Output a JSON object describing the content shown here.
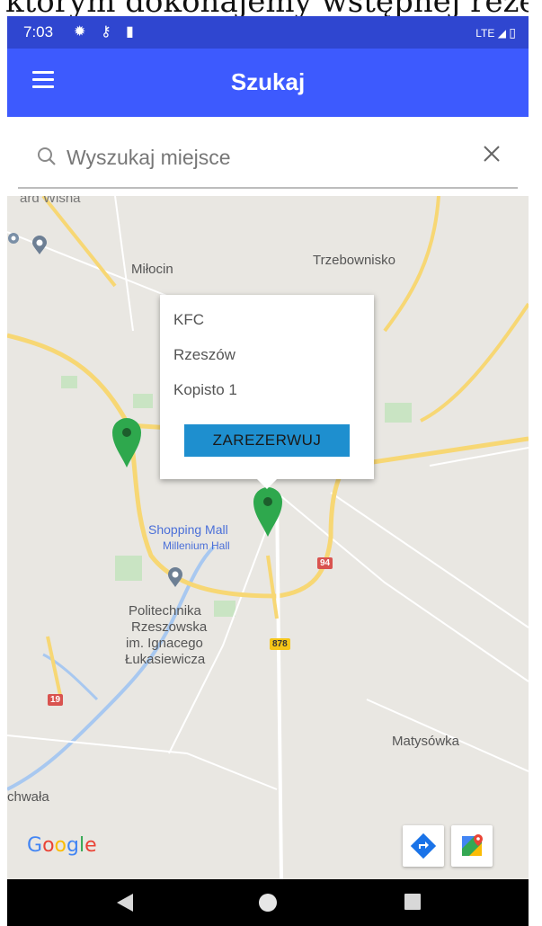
{
  "overlay_text": "którym dokonajemy wstępnej rezer",
  "status_bar": {
    "time": "7:03",
    "network": "LTE"
  },
  "app_bar": {
    "title": "Szukaj"
  },
  "search": {
    "placeholder": "Wyszukaj miejsce"
  },
  "popup": {
    "name": "KFC",
    "city": "Rzeszów",
    "address": "Kopisto 1",
    "button_label": "ZAREZERWUJ"
  },
  "map": {
    "labels": {
      "milocin": "Miłocin",
      "trzebownisko": "Trzebownisko",
      "shopping_mall": "Shopping Mall",
      "millenium_hall": "Millenium Hall",
      "politechnika_1": "Politechnika",
      "politechnika_2": "Rzeszowska",
      "politechnika_3": "im. Ignacego",
      "politechnika_4": "Łukasiewicza",
      "matysowka": "Matysówka",
      "chwala": "chwała",
      "top_left": "ard Wisna"
    },
    "routes": {
      "r94": "94",
      "r878": "878",
      "r19": "19"
    },
    "attribution": {
      "G": "G",
      "o1": "o",
      "o2": "o",
      "g": "g",
      "l": "l",
      "e": "e"
    }
  },
  "colors": {
    "app_bar": "#3d5afe",
    "status_bar": "#2f46d0",
    "reserve_button": "#1e8fcf",
    "marker": "#2ea84d",
    "map_background": "#e9e7e2"
  },
  "icons": {
    "menu": "hamburger-icon",
    "search": "search-icon",
    "close": "close-icon",
    "directions": "directions-icon",
    "maps": "google-maps-icon",
    "nav_back": "back-triangle-icon",
    "nav_home": "home-circle-icon",
    "nav_recents": "recents-square-icon"
  }
}
